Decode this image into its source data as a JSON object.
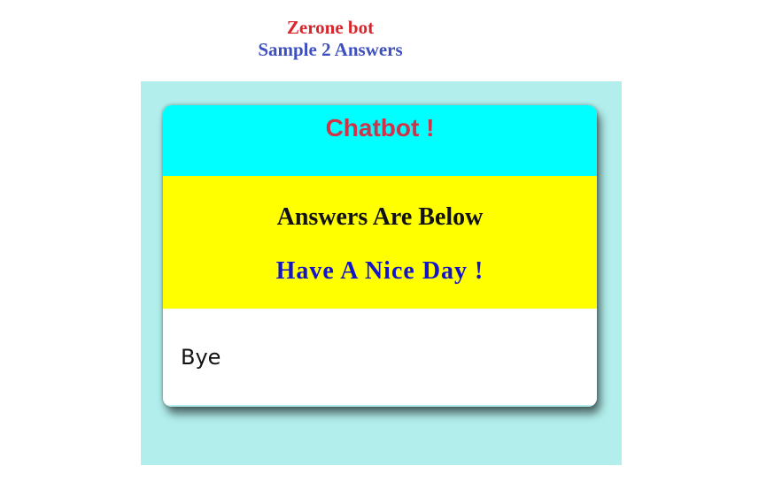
{
  "page": {
    "title": "Zerone bot",
    "subtitle": "Sample 2 Answers"
  },
  "chatbot": {
    "header_title": "Chatbot !",
    "banner_line1": "Answers Are Below",
    "banner_line2": "Have A Nice Day !",
    "answer_value": "Bye"
  },
  "colors": {
    "title": "#d9252b",
    "subtitle": "#3e4fbf",
    "panel_bg": "#b1eeec",
    "header_bg": "#00ffff",
    "header_text": "#d0324a",
    "banner_bg": "#ffff00",
    "banner_line2_text": "#1515c8"
  }
}
